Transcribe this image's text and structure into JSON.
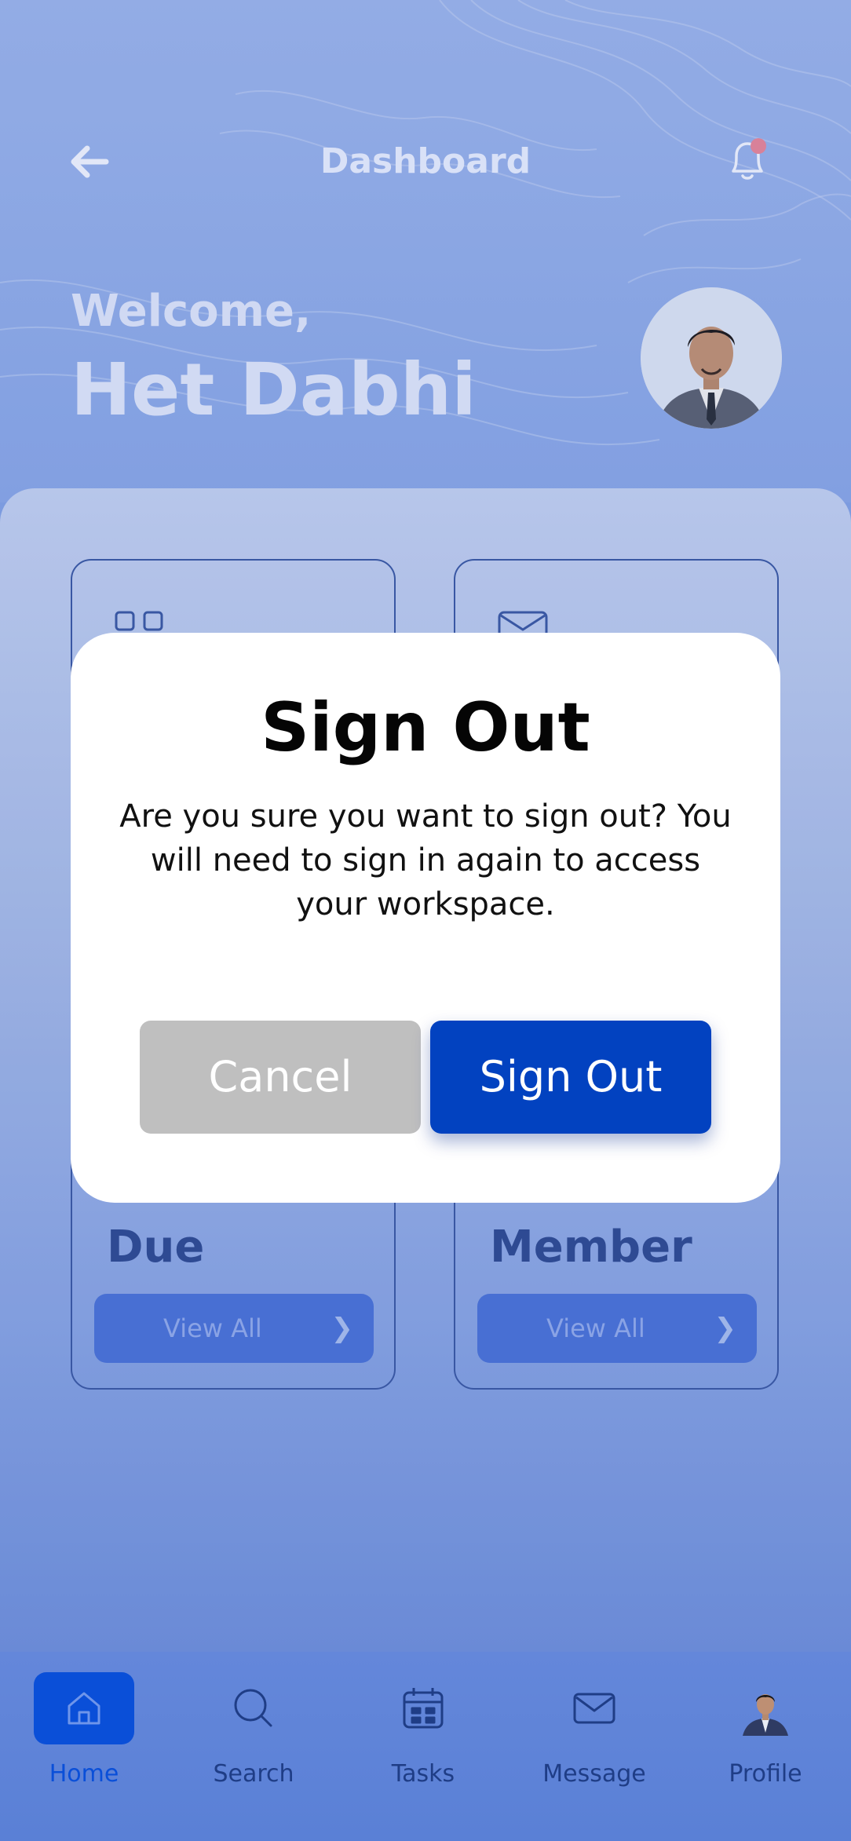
{
  "header": {
    "title": "Dashboard",
    "back_icon": "arrow-left-icon",
    "notification_icon": "bell-icon"
  },
  "welcome": {
    "greeting": "Welcome,",
    "name": "Het Dabhi"
  },
  "cards": [
    {
      "label": "Due",
      "button": "View All",
      "icon": "grid-icon"
    },
    {
      "label": "Member",
      "button": "View All",
      "icon": "mail-icon"
    }
  ],
  "dialog": {
    "title": "Sign Out",
    "message": "Are you sure you want to sign out? You will need to sign in again to access your workspace.",
    "cancel_label": "Cancel",
    "confirm_label": "Sign Out"
  },
  "tabbar": {
    "items": [
      {
        "label": "Home",
        "icon": "home-icon",
        "active": true
      },
      {
        "label": "Search",
        "icon": "search-icon",
        "active": false
      },
      {
        "label": "Tasks",
        "icon": "calendar-icon",
        "active": false
      },
      {
        "label": "Message",
        "icon": "mail-icon",
        "active": false
      },
      {
        "label": "Profile",
        "icon": "avatar-icon",
        "active": false
      }
    ]
  },
  "colors": {
    "primary": "#0242c0",
    "cancel": "#bfbfbf",
    "notification_dot": "#e8879a"
  }
}
